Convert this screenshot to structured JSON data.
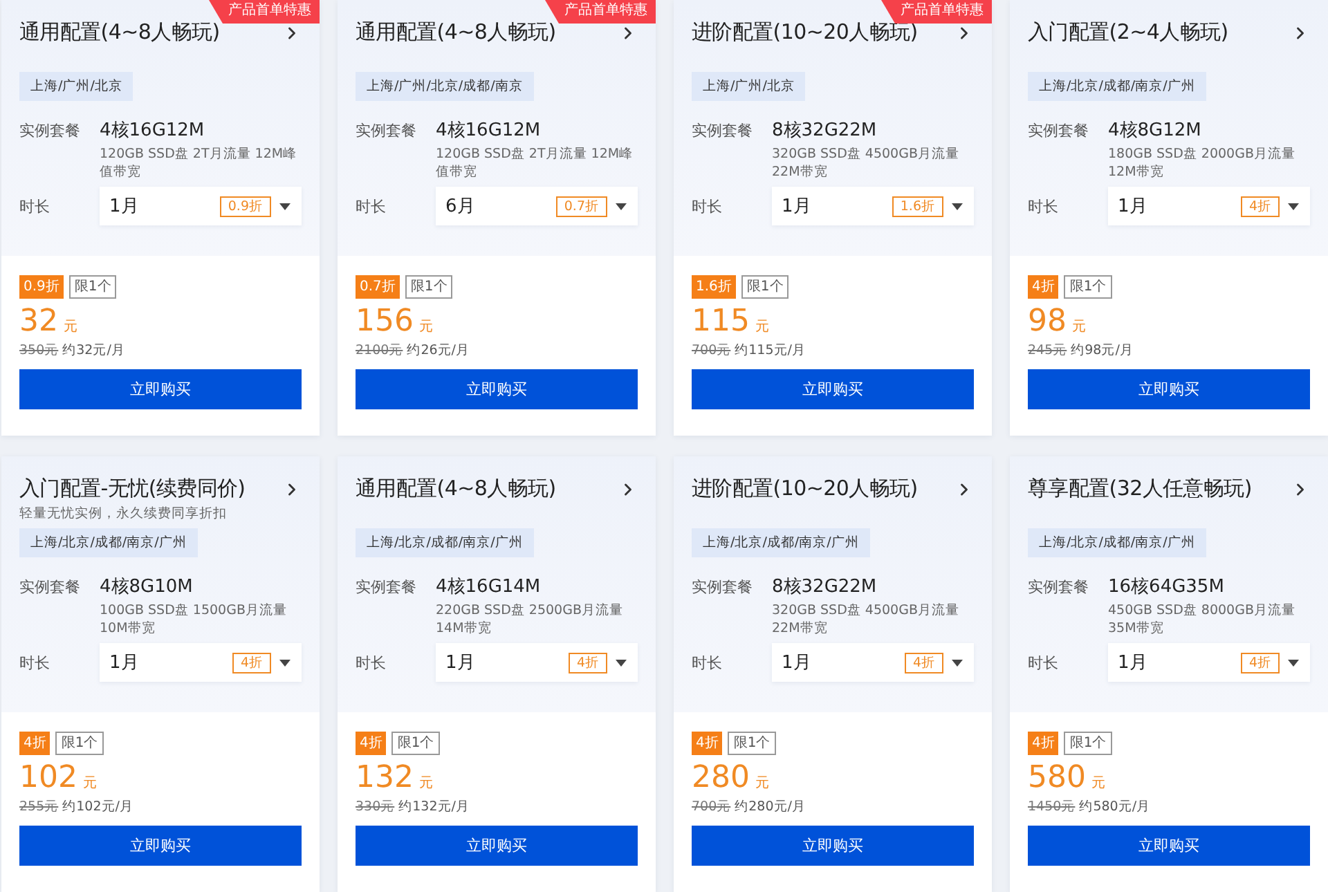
{
  "cards": [
    {
      "ribbon": "产品首单特惠",
      "title": "通用配置(4~8人畅玩)",
      "regions": "上海/广州/北京",
      "spec_label": "实例套餐",
      "spec": "4核16G12M",
      "spec_detail": "120GB SSD盘 2T月流量 12M峰值带宽",
      "duration_label": "时长",
      "duration": "1月",
      "duration_discount": "0.9折",
      "discount_badge": "0.9折",
      "limit_badge": "限1个",
      "price": "32",
      "currency": "元",
      "original_price": "350元",
      "monthly": "约32元/月",
      "buy_button": "立即购买"
    },
    {
      "ribbon": "产品首单特惠",
      "title": "通用配置(4~8人畅玩)",
      "regions": "上海/广州/北京/成都/南京",
      "spec_label": "实例套餐",
      "spec": "4核16G12M",
      "spec_detail": "120GB SSD盘 2T月流量 12M峰值带宽",
      "duration_label": "时长",
      "duration": "6月",
      "duration_discount": "0.7折",
      "discount_badge": "0.7折",
      "limit_badge": "限1个",
      "price": "156",
      "currency": "元",
      "original_price": "2100元",
      "monthly": "约26元/月",
      "buy_button": "立即购买"
    },
    {
      "ribbon": "产品首单特惠",
      "title": "进阶配置(10~20人畅玩)",
      "regions": "上海/广州/北京",
      "spec_label": "实例套餐",
      "spec": "8核32G22M",
      "spec_detail": "320GB SSD盘 4500GB月流量 22M带宽",
      "duration_label": "时长",
      "duration": "1月",
      "duration_discount": "1.6折",
      "discount_badge": "1.6折",
      "limit_badge": "限1个",
      "price": "115",
      "currency": "元",
      "original_price": "700元",
      "monthly": "约115元/月",
      "buy_button": "立即购买"
    },
    {
      "title": "入门配置(2~4人畅玩)",
      "regions": "上海/北京/成都/南京/广州",
      "spec_label": "实例套餐",
      "spec": "4核8G12M",
      "spec_detail": "180GB SSD盘 2000GB月流量 12M带宽",
      "duration_label": "时长",
      "duration": "1月",
      "duration_discount": "4折",
      "discount_badge": "4折",
      "limit_badge": "限1个",
      "price": "98",
      "currency": "元",
      "original_price": "245元",
      "monthly": "约98元/月",
      "buy_button": "立即购买"
    },
    {
      "title": "入门配置-无忧(续费同价)",
      "subtitle": "轻量无忧实例，永久续费同享折扣",
      "regions": "上海/北京/成都/南京/广州",
      "spec_label": "实例套餐",
      "spec": "4核8G10M",
      "spec_detail": "100GB SSD盘 1500GB月流量 10M带宽",
      "duration_label": "时长",
      "duration": "1月",
      "duration_discount": "4折",
      "discount_badge": "4折",
      "limit_badge": "限1个",
      "price": "102",
      "currency": "元",
      "original_price": "255元",
      "monthly": "约102元/月",
      "buy_button": "立即购买"
    },
    {
      "title": "通用配置(4~8人畅玩)",
      "regions": "上海/北京/成都/南京/广州",
      "spec_label": "实例套餐",
      "spec": "4核16G14M",
      "spec_detail": "220GB SSD盘 2500GB月流量 14M带宽",
      "duration_label": "时长",
      "duration": "1月",
      "duration_discount": "4折",
      "discount_badge": "4折",
      "limit_badge": "限1个",
      "price": "132",
      "currency": "元",
      "original_price": "330元",
      "monthly": "约132元/月",
      "buy_button": "立即购买"
    },
    {
      "title": "进阶配置(10~20人畅玩)",
      "regions": "上海/北京/成都/南京/广州",
      "spec_label": "实例套餐",
      "spec": "8核32G22M",
      "spec_detail": "320GB SSD盘 4500GB月流量 22M带宽",
      "duration_label": "时长",
      "duration": "1月",
      "duration_discount": "4折",
      "discount_badge": "4折",
      "limit_badge": "限1个",
      "price": "280",
      "currency": "元",
      "original_price": "700元",
      "monthly": "约280元/月",
      "buy_button": "立即购买"
    },
    {
      "title": "尊享配置(32人任意畅玩)",
      "regions": "上海/北京/成都/南京/广州",
      "spec_label": "实例套餐",
      "spec": "16核64G35M",
      "spec_detail": "450GB SSD盘 8000GB月流量 35M带宽",
      "duration_label": "时长",
      "duration": "1月",
      "duration_discount": "4折",
      "discount_badge": "4折",
      "limit_badge": "限1个",
      "price": "580",
      "currency": "元",
      "original_price": "1450元",
      "monthly": "约580元/月",
      "buy_button": "立即购买"
    }
  ]
}
